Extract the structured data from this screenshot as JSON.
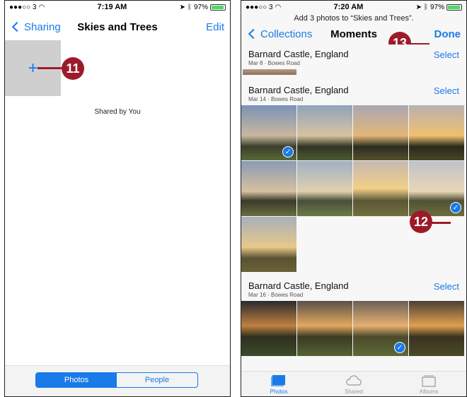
{
  "left": {
    "status": {
      "carrier": "●●●○○ 3",
      "time": "7:19 AM",
      "battery": "97%",
      "battery_level": 0.97
    },
    "nav": {
      "back_label": "Sharing",
      "title": "Skies and Trees",
      "action_label": "Edit"
    },
    "add_tile_symbol": "+",
    "shared_by": "Shared by You",
    "segments": [
      "Photos",
      "People"
    ],
    "callout": "11"
  },
  "right": {
    "status": {
      "carrier": "●●●○○ 3",
      "time": "7:20 AM",
      "battery": "97%",
      "battery_level": 0.97
    },
    "prompt": "Add 3 photos to “Skies and Trees”.",
    "nav": {
      "back_label": "Collections",
      "title": "Moments",
      "action_label": "Done"
    },
    "sections": [
      {
        "location": "Barnard Castle, England",
        "sub": "Mar 8 · Bowes Road",
        "select": "Select"
      },
      {
        "location": "Barnard Castle, England",
        "sub": "Mar 14 · Bowes Road",
        "select": "Select"
      },
      {
        "location": "Barnard Castle, England",
        "sub": "Mar 16 · Bowes Road",
        "select": "Select"
      }
    ],
    "tabs": [
      "Photos",
      "Shared",
      "Albums"
    ],
    "callout_done": "13",
    "callout_check": "12"
  },
  "colors": {
    "accent": "#1a7ae8",
    "callout": "#9c1b2a"
  }
}
